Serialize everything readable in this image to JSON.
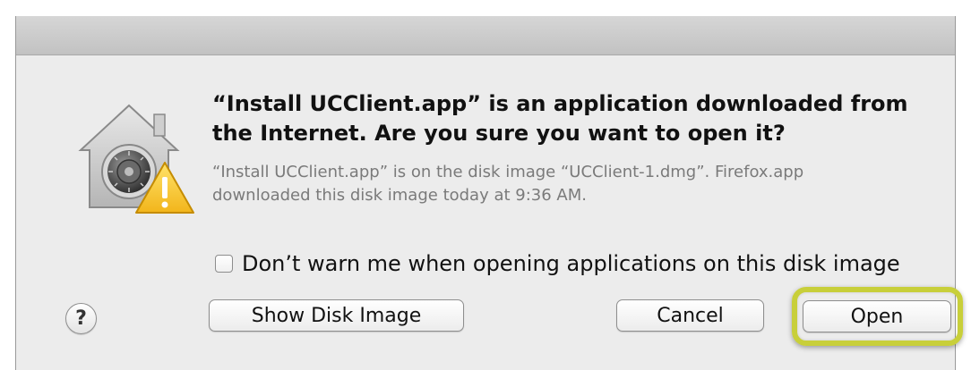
{
  "dialog": {
    "headline_line1": "“Install UCClient.app” is an application downloaded from",
    "headline_line2": "the Internet. Are you sure you want to open it?",
    "detail_line1": "“Install UCClient.app” is on the disk image “UCClient-1.dmg”. Firefox.app",
    "detail_line2": "downloaded this disk image today at 9:36 AM.",
    "checkbox_label": "Don’t warn me when opening applications on this disk image",
    "checkbox_checked": false,
    "icon": "gatekeeper-warning-icon",
    "help_label": "?",
    "buttons": {
      "show_disk_image": "Show Disk Image",
      "cancel": "Cancel",
      "open": "Open"
    },
    "highlight_color": "#c8cf3a"
  }
}
